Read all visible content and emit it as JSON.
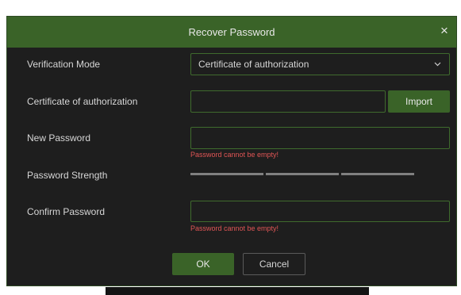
{
  "dialog": {
    "title": "Recover Password",
    "close_glyph": "×",
    "close_icon": "close-icon"
  },
  "form": {
    "verification_mode": {
      "label": "Verification Mode",
      "selected": "Certificate of authorization",
      "icon": "chevron-down-icon"
    },
    "certificate": {
      "label": "Certificate of authorization",
      "value": "",
      "import_label": "Import"
    },
    "new_password": {
      "label": "New Password",
      "value": "",
      "error": "Password cannot be empty!"
    },
    "strength": {
      "label": "Password Strength",
      "levels_filled": 0,
      "levels_total": 3
    },
    "confirm_password": {
      "label": "Confirm Password",
      "value": "",
      "error": "Password cannot be empty!"
    }
  },
  "actions": {
    "ok_label": "OK",
    "cancel_label": "Cancel"
  },
  "colors": {
    "accent": "#3a6328",
    "field_border": "#3f6b2d",
    "error": "#e05555",
    "background": "#1e1e1e"
  }
}
